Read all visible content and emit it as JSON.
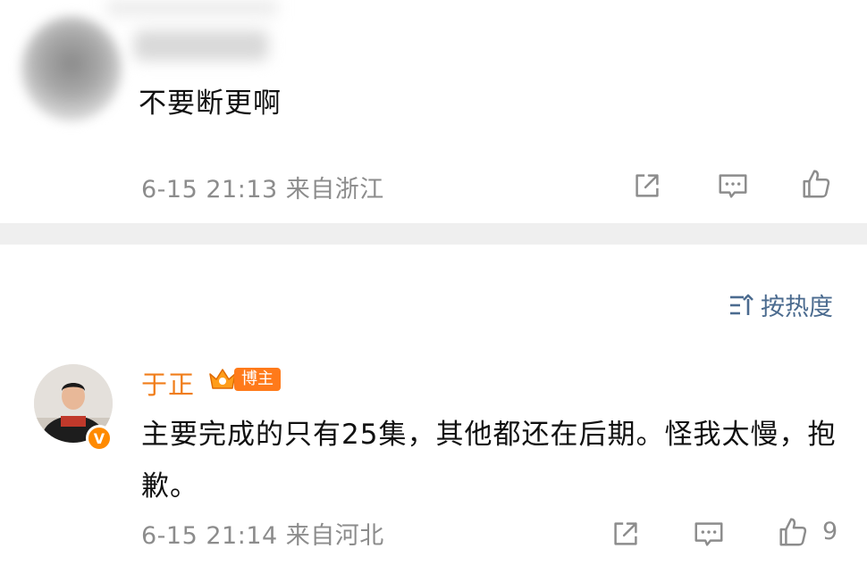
{
  "post1": {
    "text": "不要断更啊",
    "meta": "6-15 21:13 来自浙江"
  },
  "sort": {
    "label": "按热度"
  },
  "post2": {
    "author": "于正",
    "badge": "博主",
    "text": "主要完成的只有25集，其他都还在后期。怪我太慢，抱歉。",
    "meta": "6-15 21:14 来自河北",
    "likes": "9"
  },
  "colors": {
    "author_name": "#f07d1a",
    "badge_bg": "#ff7a1a",
    "sort_text": "#4b6b8f",
    "meta_text": "#8c8c8c",
    "divider": "#efefef"
  },
  "icons": [
    "share-icon",
    "comment-icon",
    "like-icon",
    "sort-icon",
    "crown-icon",
    "verified-v-icon"
  ]
}
